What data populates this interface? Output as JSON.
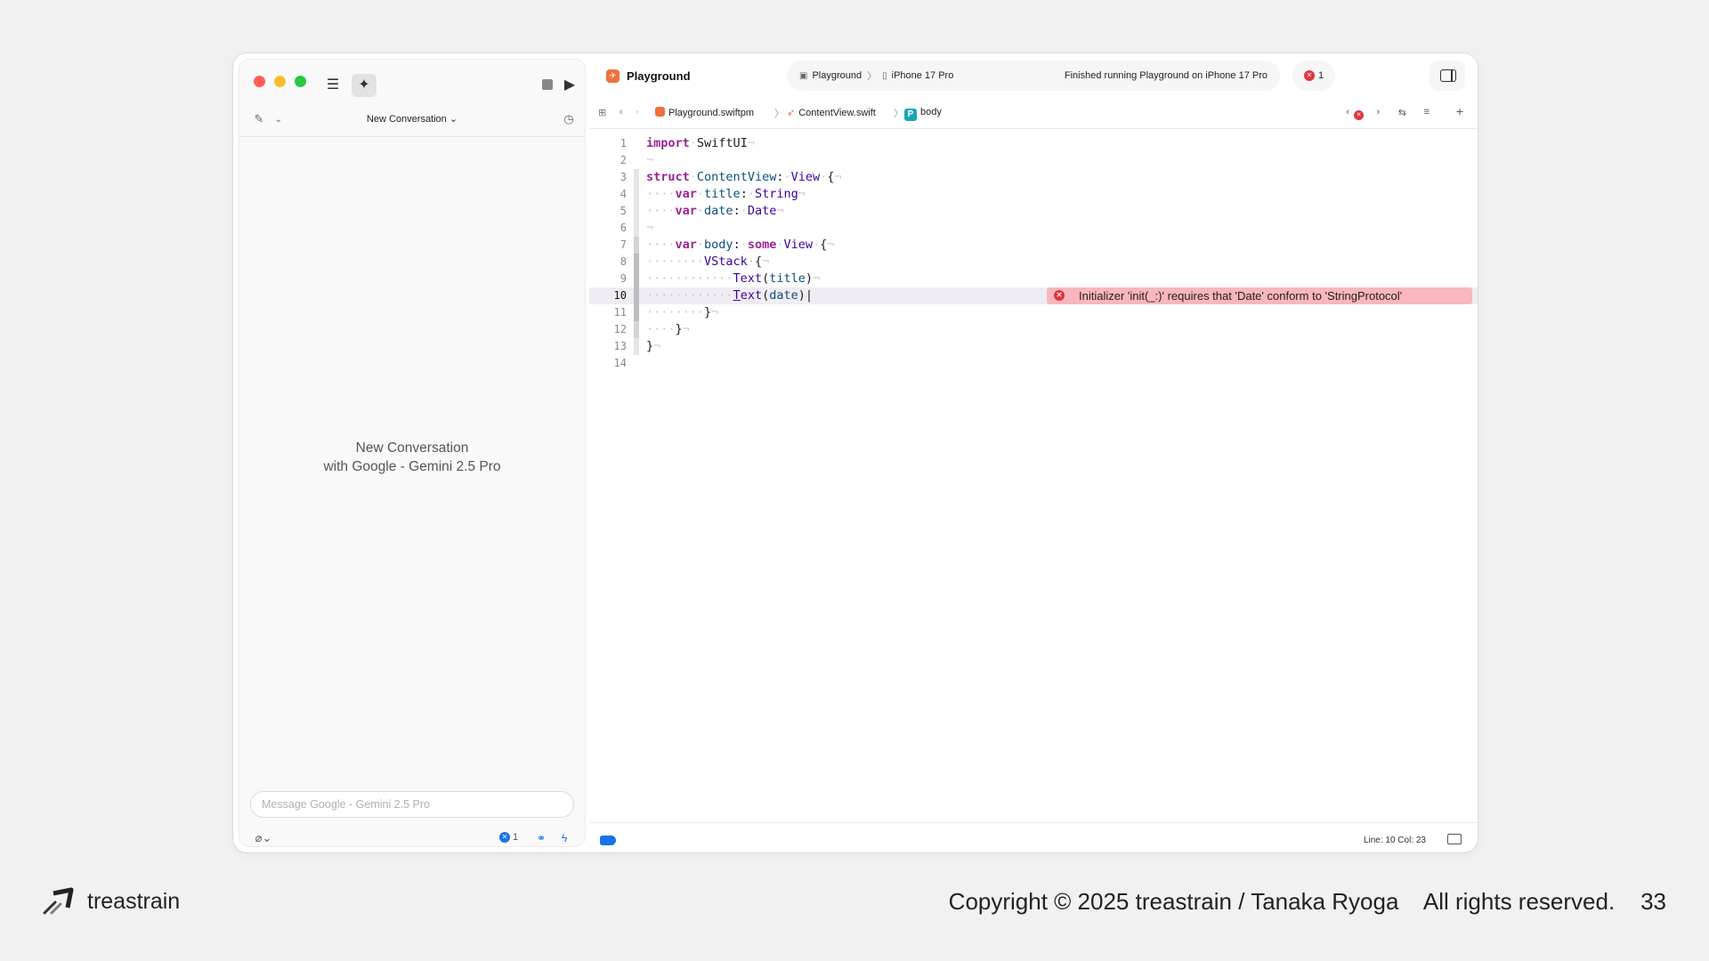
{
  "sidebar": {
    "conversation_title": "New Conversation",
    "empty_title": "New Conversation",
    "empty_subtitle": "with Google - Gemini 2.5 Pro",
    "input_placeholder": "Message Google - Gemini 2.5 Pro",
    "issue_count": "1"
  },
  "toolbar": {
    "project_name": "Playground",
    "scheme": "Playground",
    "device": "iPhone 17 Pro",
    "status": "Finished running Playground on iPhone 17 Pro",
    "error_count": "1"
  },
  "jumpbar": {
    "package": "Playground.swiftpm",
    "file": "ContentView.swift",
    "symbol": "body",
    "symbol_badge": "P"
  },
  "editor": {
    "lines": [
      {
        "n": "1",
        "html": "<span class='kw'>import</span><span class='ws'>·</span>SwiftUI<span class='ws'>¬</span>"
      },
      {
        "n": "2",
        "html": "<span class='ws'>¬</span>"
      },
      {
        "n": "3",
        "html": "<span class='kw'>struct</span><span class='ws'>·</span><span class='id'>ContentView</span>:<span class='ws'>·</span><span class='ty'>View</span><span class='ws'>·</span>{<span class='ws'>¬</span>"
      },
      {
        "n": "4",
        "html": "<span class='ws'>····</span><span class='kw'>var</span><span class='ws'>·</span><span class='id'>title</span>:<span class='ws'>·</span><span class='ty'>String</span><span class='ws'>¬</span>"
      },
      {
        "n": "5",
        "html": "<span class='ws'>····</span><span class='kw'>var</span><span class='ws'>·</span><span class='id'>date</span>:<span class='ws'>·</span><span class='ty'>Date</span><span class='ws'>¬</span>"
      },
      {
        "n": "6",
        "html": "<span class='ws'>¬</span>"
      },
      {
        "n": "7",
        "html": "<span class='ws'>····</span><span class='kw'>var</span><span class='ws'>·</span><span class='id'>body</span>:<span class='ws'>·</span><span class='kw'>some</span><span class='ws'>·</span><span class='ty'>View</span><span class='ws'>·</span>{<span class='ws'>¬</span>"
      },
      {
        "n": "8",
        "html": "<span class='ws'>········</span><span class='ty'>VStack</span><span class='ws'>·</span>{<span class='ws'>¬</span>"
      },
      {
        "n": "9",
        "html": "<span class='ws'>············</span><span class='ty'>Text</span>(<span class='id'>title</span>)<span class='ws'>¬</span>"
      },
      {
        "n": "10",
        "html": "<span class='ws'>············</span><span class='ty'><u>T</u>ext</span>(<span class='id'>date</span>)|"
      },
      {
        "n": "11",
        "html": "<span class='ws'>········</span>}<span class='ws'>¬</span>"
      },
      {
        "n": "12",
        "html": "<span class='ws'>····</span>}<span class='ws'>¬</span>"
      },
      {
        "n": "13",
        "html": "}<span class='ws'>¬</span>"
      },
      {
        "n": "14",
        "html": ""
      }
    ],
    "error_message": "Initializer 'init(_:)' requires that 'Date' conform to 'StringProtocol'",
    "error_line": "10"
  },
  "statusbar": {
    "position": "Line: 10  Col: 23"
  },
  "footer": {
    "brand": "treastrain",
    "copyright": "Copyright © 2025 treastrain / Tanaka Ryoga    All rights reserved.    33"
  }
}
